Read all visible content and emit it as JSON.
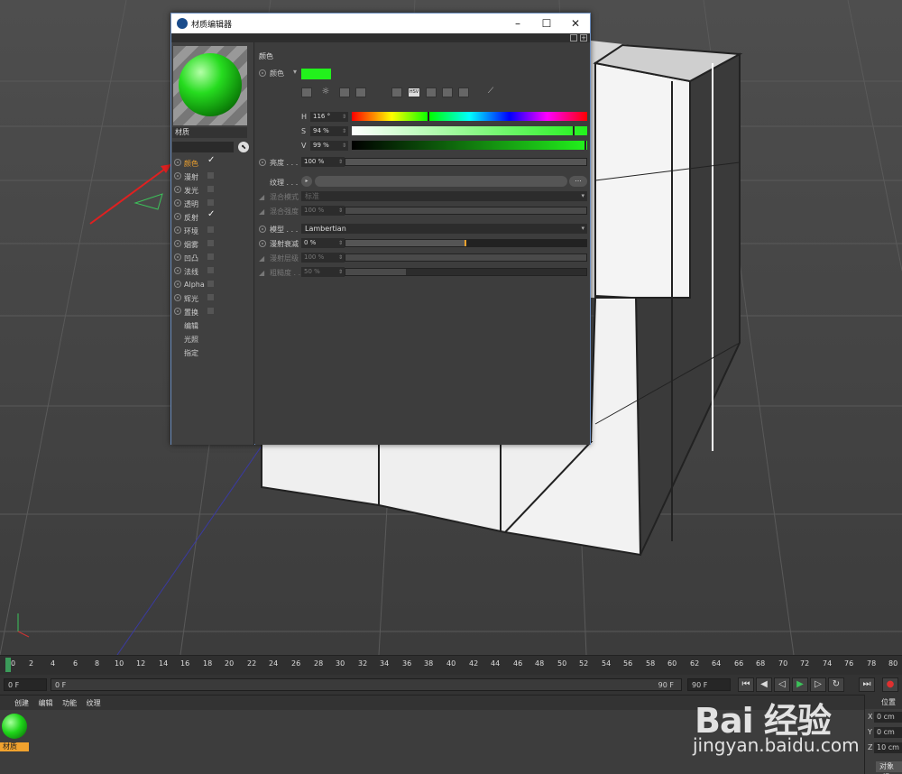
{
  "editor": {
    "title": "材质编辑器",
    "material_name": "材质",
    "channels": [
      {
        "label": "颜色",
        "checked": true,
        "active": true
      },
      {
        "label": "漫射",
        "checked": false
      },
      {
        "label": "发光",
        "checked": false
      },
      {
        "label": "透明",
        "checked": false
      },
      {
        "label": "反射",
        "checked": true
      },
      {
        "label": "环境",
        "checked": false
      },
      {
        "label": "烟雾",
        "checked": false
      },
      {
        "label": "凹凸",
        "checked": false
      },
      {
        "label": "法线",
        "checked": false
      },
      {
        "label": "Alpha",
        "checked": false
      },
      {
        "label": "辉光",
        "checked": false
      },
      {
        "label": "置换",
        "checked": false
      }
    ],
    "extras": [
      "编辑",
      "光照",
      "指定"
    ],
    "color_section": {
      "header": "颜色",
      "color_label": "颜色",
      "swatch_color": "#22f21c",
      "mode_icons": [
        "picker-icon",
        "wheel-icon",
        "spectrum-icon",
        "image-icon",
        "rgb-mode-icon",
        "hsv-mode-icon",
        "kelvin-mode-icon",
        "mixer-icon",
        "swatches-icon",
        "eyedropper-icon"
      ],
      "hsv_mode_label": "HSV",
      "h_label": "H",
      "h_value": "116 °",
      "h_fraction": 0.32,
      "s_label": "S",
      "s_value": "94 %",
      "s_fraction": 0.94,
      "v_label": "V",
      "v_value": "99 %",
      "v_fraction": 0.99,
      "brightness_label": "亮度 . . .",
      "brightness_value": "100 %",
      "brightness_fraction": 1.0,
      "texture_label": "纹理 . . .",
      "texture_more": "...",
      "blend_mode_label": "混合模式",
      "blend_mode_value": "标准",
      "blend_strength_label": "混合强度",
      "blend_strength_value": "100 %",
      "blend_strength_fraction": 1.0,
      "model_label": "模型 . . .",
      "model_value": "Lambertian",
      "diffuse_falloff_label": "漫射衰减",
      "diffuse_falloff_value": "0 %",
      "diffuse_falloff_fraction": 0.5,
      "diffuse_level_label": "漫射层级",
      "diffuse_level_value": "100 %",
      "diffuse_level_fraction": 1.0,
      "roughness_label": "粗糙度 . .",
      "roughness_value": "50 %",
      "roughness_fraction": 0.25
    }
  },
  "timeline": {
    "ticks": [
      "0",
      "2",
      "4",
      "6",
      "8",
      "10",
      "12",
      "14",
      "16",
      "18",
      "20",
      "22",
      "24",
      "26",
      "28",
      "30",
      "32",
      "34",
      "36",
      "38",
      "40",
      "42",
      "44",
      "46",
      "48",
      "50",
      "52",
      "54",
      "56",
      "58",
      "60",
      "62",
      "64",
      "66",
      "68",
      "70",
      "72",
      "74",
      "76",
      "78",
      "80"
    ],
    "start_field": "0 F",
    "range_start": "0 F",
    "range_end": "90 F",
    "end_field": "90 F"
  },
  "material_manager": {
    "menu": [
      "创建",
      "编辑",
      "功能",
      "纹理"
    ],
    "material_label": "材质"
  },
  "coordinates": {
    "header": "位置",
    "x_label": "X",
    "x_value": "0 cm",
    "y_label": "Y",
    "y_value": "0 cm",
    "z_label": "Z",
    "z_value": "10 cm",
    "mode_button": "对象 (相"
  },
  "watermark": {
    "logo": "Bai 经验",
    "url": "jingyan.baidu.com"
  },
  "colors": {
    "accent": "#f0a22e",
    "material_green": "#22f21c"
  }
}
